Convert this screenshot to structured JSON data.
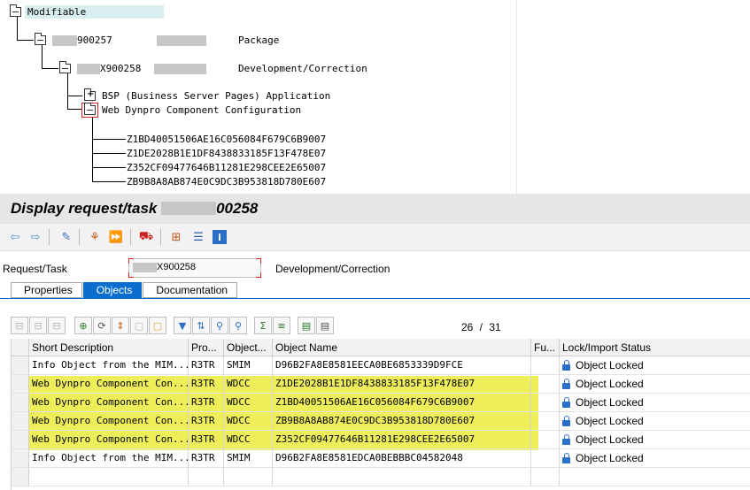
{
  "tree": {
    "root_label": "Modifiable",
    "package_id_suffix": "900257",
    "package_type": "Package",
    "task_id_suffix": "X900258",
    "task_type": "Development/Correction",
    "type_bsp": "BSP (Business Server Pages) Application",
    "type_wdcc": "Web Dynpro Component Configuration",
    "objects": [
      "Z1BD40051506AE16C056084F679C6B9007",
      "Z1DE2028B1E1DF8438833185F13F478E07",
      "Z352CF09477646B11281E298CEE2E65007",
      "ZB9B8A8AB874E0C9DC3B953818D780E607"
    ]
  },
  "title": {
    "prefix": "Display request/task",
    "suffix": "00258"
  },
  "toolbar": {
    "icons": [
      "back-icon",
      "forward-icon",
      "display-change-icon",
      "hierarchy-icon",
      "release-icon",
      "transport-icon",
      "org-structure-icon",
      "sort-icon",
      "info-icon"
    ]
  },
  "header": {
    "request_task_label": "Request/Task",
    "request_task_value": "X900258",
    "request_task_desc": "Development/Correction"
  },
  "tabs": [
    {
      "label": "Properties",
      "active": false
    },
    {
      "label": "Objects",
      "active": true
    },
    {
      "label": "Documentation",
      "active": false
    }
  ],
  "pager": {
    "text": "26 / 31"
  },
  "grid": {
    "columns": [
      "Short Description",
      "Pro...",
      "Object...",
      "Object Name",
      "Fu...",
      "Lock/Import Status"
    ],
    "rows": [
      {
        "desc": "Info Object from the MIM...",
        "pgmid": "R3TR",
        "object": "SMIM",
        "name": "D96B2FA8E8581EECA0BE6853339D9FCE",
        "fu": "",
        "status": "Object Locked",
        "highlight": false
      },
      {
        "desc": "Web Dynpro Component Con...",
        "pgmid": "R3TR",
        "object": "WDCC",
        "name": "Z1DE2028B1E1DF8438833185F13F478E07",
        "fu": "",
        "status": "Object Locked",
        "highlight": true
      },
      {
        "desc": "Web Dynpro Component Con...",
        "pgmid": "R3TR",
        "object": "WDCC",
        "name": "Z1BD40051506AE16C056084F679C6B9007",
        "fu": "",
        "status": "Object Locked",
        "highlight": true
      },
      {
        "desc": "Web Dynpro Component Con...",
        "pgmid": "R3TR",
        "object": "WDCC",
        "name": "ZB9B8A8AB874E0C9DC3B953818D780E607",
        "fu": "",
        "status": "Object Locked",
        "highlight": true
      },
      {
        "desc": "Web Dynpro Component Con...",
        "pgmid": "R3TR",
        "object": "WDCC",
        "name": "Z352CF09477646B11281E298CEE2E65007",
        "fu": "",
        "status": "Object Locked",
        "highlight": true
      },
      {
        "desc": "Info Object from the MIM...",
        "pgmid": "R3TR",
        "object": "SMIM",
        "name": "D96B2FA8E8581EDCA0BEBBBC04582048",
        "fu": "",
        "status": "Object Locked",
        "highlight": false
      }
    ]
  },
  "colors": {
    "accent": "#0a6ed1",
    "highlight": "#eeee5a",
    "lock": "#2a6fc9"
  }
}
